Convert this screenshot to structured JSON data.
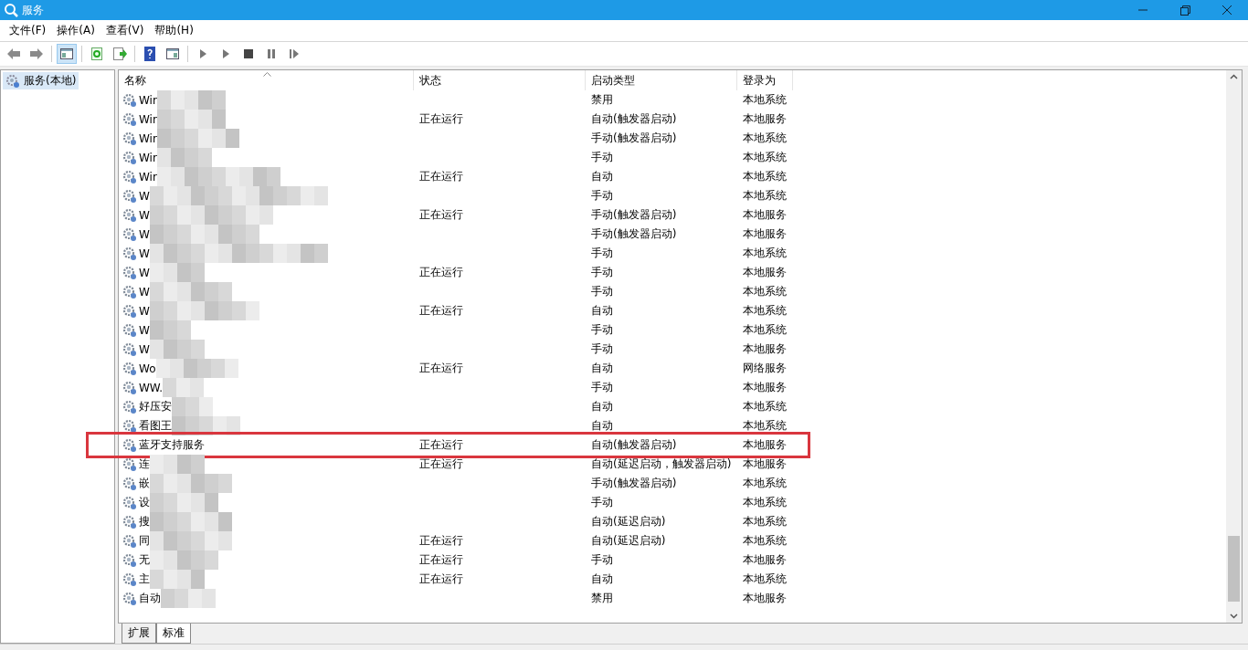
{
  "window": {
    "title": "服务"
  },
  "menu": [
    "文件(F)",
    "操作(A)",
    "查看(V)",
    "帮助(H)"
  ],
  "toolbar": [
    {
      "kind": "back",
      "selected": false
    },
    {
      "kind": "forward",
      "selected": false
    },
    {
      "kind": "sep"
    },
    {
      "kind": "tree",
      "selected": true
    },
    {
      "kind": "sep"
    },
    {
      "kind": "refresh",
      "selected": false
    },
    {
      "kind": "export",
      "selected": false
    },
    {
      "kind": "sep"
    },
    {
      "kind": "help",
      "selected": false
    },
    {
      "kind": "pane",
      "selected": false
    },
    {
      "kind": "sep"
    },
    {
      "kind": "play",
      "selected": false
    },
    {
      "kind": "play",
      "selected": false
    },
    {
      "kind": "stop",
      "selected": false
    },
    {
      "kind": "pause",
      "selected": false
    },
    {
      "kind": "resume",
      "selected": false
    }
  ],
  "tree": {
    "label": "服务(本地)",
    "selected": true
  },
  "table": {
    "columns": [
      "名称",
      "状态",
      "启动类型",
      "登录为"
    ],
    "rows": [
      {
        "name": "Wir",
        "status": "",
        "startup": "禁用",
        "logon": "本地系统",
        "highlighted": false
      },
      {
        "name": "Wir",
        "status": "正在运行",
        "startup": "自动(触发器启动)",
        "logon": "本地服务",
        "highlighted": false
      },
      {
        "name": "Wir",
        "status": "",
        "startup": "手动(触发器启动)",
        "logon": "本地系统",
        "highlighted": false
      },
      {
        "name": "Wir",
        "status": "",
        "startup": "手动",
        "logon": "本地系统",
        "highlighted": false
      },
      {
        "name": "Wir",
        "status": "正在运行",
        "startup": "自动",
        "logon": "本地系统",
        "highlighted": false
      },
      {
        "name": "W",
        "status": "",
        "startup": "手动",
        "logon": "本地系统",
        "highlighted": false
      },
      {
        "name": "W",
        "status": "正在运行",
        "startup": "手动(触发器启动)",
        "logon": "本地服务",
        "highlighted": false
      },
      {
        "name": "W",
        "status": "",
        "startup": "手动(触发器启动)",
        "logon": "本地服务",
        "highlighted": false
      },
      {
        "name": "W",
        "status": "",
        "startup": "手动",
        "logon": "本地系统",
        "highlighted": false
      },
      {
        "name": "W",
        "status": "正在运行",
        "startup": "手动",
        "logon": "本地服务",
        "highlighted": false
      },
      {
        "name": "W",
        "status": "",
        "startup": "手动",
        "logon": "本地系统",
        "highlighted": false
      },
      {
        "name": "W",
        "status": "正在运行",
        "startup": "自动",
        "logon": "本地系统",
        "highlighted": false
      },
      {
        "name": "W",
        "status": "",
        "startup": "手动",
        "logon": "本地系统",
        "highlighted": false
      },
      {
        "name": "W",
        "status": "",
        "startup": "手动",
        "logon": "本地服务",
        "highlighted": false
      },
      {
        "name": "Wo",
        "status": "正在运行",
        "startup": "自动",
        "logon": "网络服务",
        "highlighted": false
      },
      {
        "name": "WW.",
        "status": "",
        "startup": "手动",
        "logon": "本地服务",
        "highlighted": false
      },
      {
        "name": "好压安",
        "status": "",
        "startup": "自动",
        "logon": "本地系统",
        "highlighted": false
      },
      {
        "name": "看图王",
        "status": "",
        "startup": "自动",
        "logon": "本地系统",
        "highlighted": false
      },
      {
        "name": "蓝牙支持服务",
        "status": "正在运行",
        "startup": "自动(触发器启动)",
        "logon": "本地服务",
        "highlighted": true
      },
      {
        "name": "连",
        "status": "正在运行",
        "startup": "自动(延迟启动，触发器启动)",
        "logon": "本地服务",
        "highlighted": false
      },
      {
        "name": "嵌",
        "status": "",
        "startup": "手动(触发器启动)",
        "logon": "本地系统",
        "highlighted": false
      },
      {
        "name": "设",
        "status": "",
        "startup": "手动",
        "logon": "本地系统",
        "highlighted": false
      },
      {
        "name": "搜",
        "status": "",
        "startup": "自动(延迟启动)",
        "logon": "本地系统",
        "highlighted": false
      },
      {
        "name": "同",
        "status": "正在运行",
        "startup": "自动(延迟启动)",
        "logon": "本地系统",
        "highlighted": false
      },
      {
        "name": "无",
        "status": "正在运行",
        "startup": "手动",
        "logon": "本地服务",
        "highlighted": false
      },
      {
        "name": "主",
        "status": "正在运行",
        "startup": "自动",
        "logon": "本地系统",
        "highlighted": false
      },
      {
        "name": "自动",
        "status": "",
        "startup": "禁用",
        "logon": "本地服务",
        "highlighted": false
      }
    ]
  },
  "tabs": [
    {
      "label": "扩展",
      "selected": false
    },
    {
      "label": "标准",
      "selected": true
    }
  ]
}
